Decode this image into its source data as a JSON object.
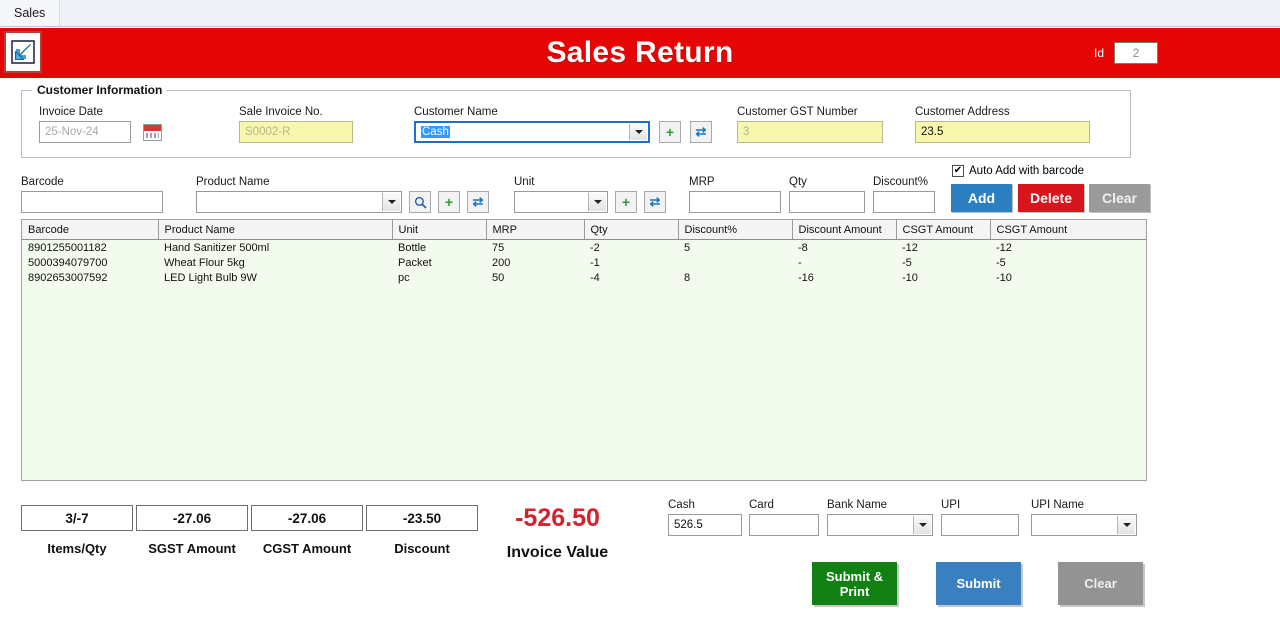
{
  "menubar": {
    "items": [
      {
        "label": "Sales"
      }
    ]
  },
  "titlebar": {
    "title": "Sales Return",
    "app_icon": "return-arrow-icon",
    "id_label": "Id",
    "id_value": "2",
    "bg_color": "#e60505"
  },
  "customer_information": {
    "legend": "Customer Information",
    "invoice_date": {
      "label": "Invoice Date",
      "value": "25-Nov-24",
      "placeholder": true
    },
    "calendar_icon": "calendar-icon",
    "sale_invoice_no": {
      "label": "Sale Invoice No.",
      "value": "S0002-R",
      "placeholder": true
    },
    "customer_name": {
      "label": "Customer Name",
      "value": "Cash"
    },
    "add_customer_button": "+",
    "refresh_customer_button": "⇄",
    "customer_gst_number": {
      "label": "Customer GST Number",
      "value": "3",
      "placeholder": true
    },
    "customer_address": {
      "label": "Customer Address",
      "value": "23.5"
    }
  },
  "entry_row": {
    "barcode": {
      "label": "Barcode",
      "value": ""
    },
    "product_name": {
      "label": "Product Name",
      "value": ""
    },
    "search_product_button": "⚲",
    "add_product_button": "+",
    "refresh_product_button": "⇄",
    "unit": {
      "label": "Unit",
      "value": ""
    },
    "add_unit_button": "+",
    "refresh_unit_button": "⇄",
    "mrp": {
      "label": "MRP",
      "value": ""
    },
    "qty": {
      "label": "Qty",
      "value": ""
    },
    "discount_pct": {
      "label": "Discount%",
      "value": ""
    },
    "auto_add_checkbox": {
      "label": "Auto Add with barcode",
      "checked": true,
      "mark": "✔"
    },
    "add_button": "Add",
    "delete_button": "Delete",
    "clear_button": "Clear"
  },
  "grid": {
    "columns": [
      "Barcode",
      "Product Name",
      "Unit",
      "MRP",
      "Qty",
      "Discount%",
      "Discount Amount",
      "CSGT Amount",
      "CSGT Amount"
    ],
    "rows": [
      [
        "8901255001182",
        "Hand Sanitizer 500ml",
        "Bottle",
        "75",
        "-2",
        "5",
        "-8",
        "-12",
        "-12"
      ],
      [
        "5000394079700",
        "Wheat Flour 5kg",
        "Packet",
        "200",
        "-1",
        "",
        "-",
        "-5",
        "-5"
      ],
      [
        "8902653007592",
        "LED Light Bulb 9W",
        "pc",
        "50",
        "-4",
        "8",
        "-16",
        "-10",
        "-10"
      ]
    ]
  },
  "totals": [
    {
      "value": "3/-7",
      "caption": "Items/Qty"
    },
    {
      "value": "-27.06",
      "caption": "SGST Amount"
    },
    {
      "value": "-27.06",
      "caption": "CGST Amount"
    },
    {
      "value": "-23.50",
      "caption": "Discount"
    }
  ],
  "invoice_value": {
    "amount": "-526.50",
    "caption": "Invoice Value",
    "color": "#d3242d"
  },
  "payment": {
    "cash": {
      "label": "Cash",
      "value": "526.5"
    },
    "card": {
      "label": "Card",
      "value": ""
    },
    "bank_name": {
      "label": "Bank Name",
      "value": ""
    },
    "upi": {
      "label": "UPI",
      "value": ""
    },
    "upi_name": {
      "label": "UPI Name",
      "value": ""
    }
  },
  "actions": {
    "submit_print": "Submit & Print",
    "submit": "Submit",
    "clear": "Clear"
  }
}
